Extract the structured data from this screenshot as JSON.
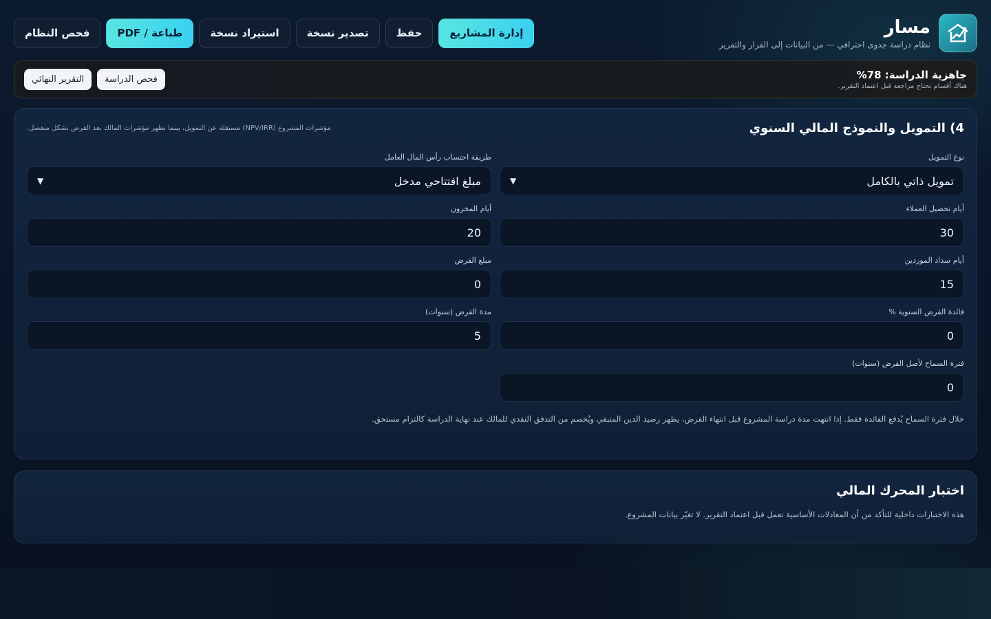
{
  "app": {
    "title": "مسار",
    "subtitle": "نظام دراسة جدوى احترافي — من البيانات إلى القرار والتقرير",
    "logo_icon": "chart-house-icon"
  },
  "toolbar": {
    "projects": "إدارة المشاريع",
    "save": "حفظ",
    "export": "تصدير نسخة",
    "import": "استيراد نسخة",
    "print": "طباعة / PDF",
    "check": "فحص النظام"
  },
  "readiness": {
    "title": "جاهزية الدراسة: 78%",
    "subtitle": "هناك أقسام تحتاج مراجعة قبل اعتماد التقرير.",
    "check_study": "فحص الدراسة",
    "final_report": "التقرير النهائي",
    "percent": 78
  },
  "financing": {
    "title": "4) التمويل والنموذج المالي السنوي",
    "note": "مؤشرات المشروع (NPV/IRR) مستقلة عن التمويل، بينما تظهر مؤشرات المالك بعد القرض بشكل منفصل.",
    "fields": {
      "financing_type": {
        "label": "نوع التمويل",
        "value": "تمويل ذاتي بالكامل"
      },
      "working_capital": {
        "label": "طريقة احتساب رأس المال العامل",
        "value": "مبلغ افتتاحي مدخل"
      },
      "receivable_days": {
        "label": "أيام تحصيل العملاء",
        "value": "30"
      },
      "inventory_days": {
        "label": "أيام المخزون",
        "value": "20"
      },
      "payable_days": {
        "label": "أيام سداد الموردين",
        "value": "15"
      },
      "loan_amount": {
        "label": "مبلغ القرض",
        "value": "0"
      },
      "interest": {
        "label": "فائدة القرض السنوية %",
        "value": "0"
      },
      "loan_term": {
        "label": "مدة القرض (سنوات)",
        "value": "5"
      },
      "grace": {
        "label": "فترة السماح لأصل القرض (سنوات)",
        "value": "0"
      }
    },
    "footnote": "خلال فترة السماح يُدفع الفائدة فقط. إذا انتهت مدة دراسة المشروع قبل انتهاء القرض، يظهر رصيد الدين المتبقي ويُخصم من التدفق النقدي للمالك عند نهاية الدراسة كالتزام مستحق."
  },
  "engine": {
    "title": "اختبار المحرك المالي",
    "desc": "هذه الاختبارات داخلية للتأكد من أن المعادلات الأساسية تعمل قبل اعتماد التقرير. لا تغيّر بيانات المشروع."
  },
  "colors": {
    "accent": "#3ad0f0",
    "background": "#0c1a2e",
    "card": "#12253f"
  }
}
